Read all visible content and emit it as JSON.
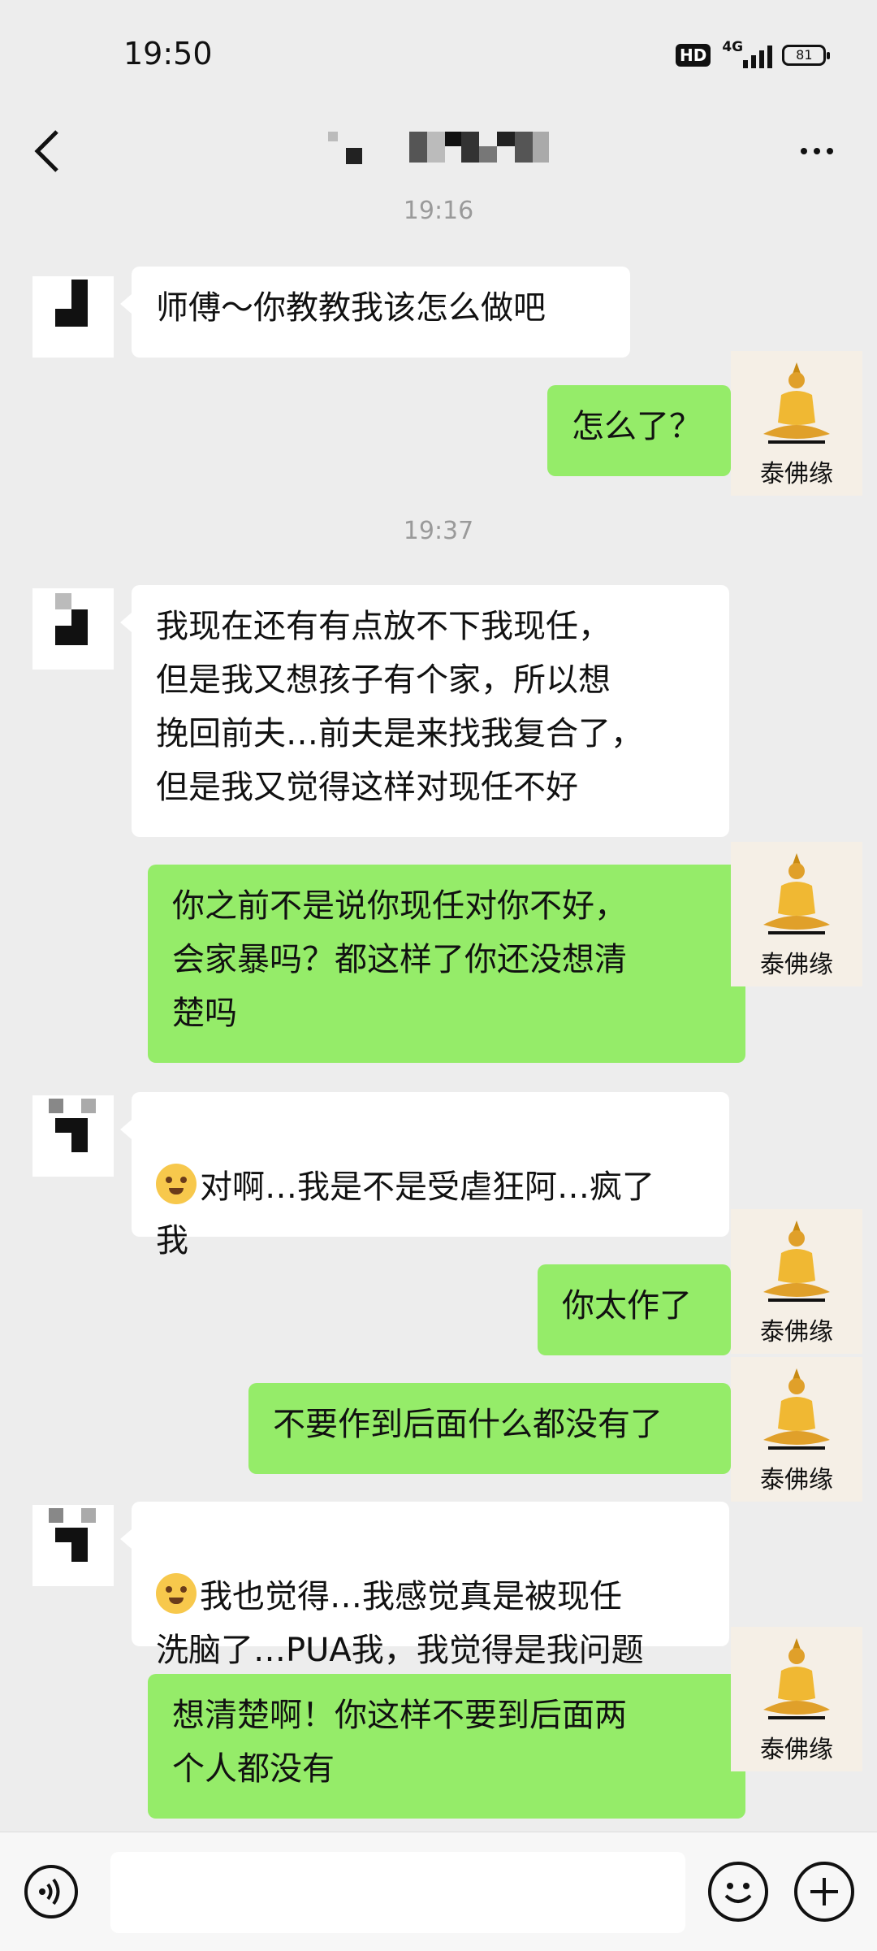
{
  "status_bar": {
    "time": "19:50",
    "hd": "HD",
    "network": "4G",
    "battery": "81"
  },
  "header": {
    "back_icon": "chevron-left-icon",
    "title_censored": true,
    "more_icon": "more-dots-icon"
  },
  "messages": [
    {
      "kind": "timestamp",
      "text": "19:16"
    },
    {
      "kind": "in",
      "text": "师傅～你教教我该怎么做吧"
    },
    {
      "kind": "out",
      "text": "怎么了？"
    },
    {
      "kind": "timestamp",
      "text": "19:37"
    },
    {
      "kind": "in",
      "text": "我现在还有有点放不下我现任，\n但是我又想孩子有个家，所以想\n挽回前夫…前夫是来找我复合了，\n但是我又觉得这样对现任不好"
    },
    {
      "kind": "out",
      "text": "你之前不是说你现任对你不好，\n会家暴吗？都这样了你还没想清\n楚吗"
    },
    {
      "kind": "in",
      "emoji": "crying-emoji",
      "text": "对啊…我是不是受虐狂阿…疯了\n我"
    },
    {
      "kind": "out",
      "text": "你太作了"
    },
    {
      "kind": "out",
      "text": "不要作到后面什么都没有了"
    },
    {
      "kind": "in",
      "emoji": "flushed-emoji",
      "text": "我也觉得…我感觉真是被现任\n洗脑了…PUA我，我觉得是我问题"
    },
    {
      "kind": "out",
      "text": "想清楚啊！你这样不要到后面两\n个人都没有"
    }
  ],
  "self_avatar": {
    "brand": "泰佛缘",
    "icon": "buddha-icon"
  },
  "input_bar": {
    "voice_icon": "voice-icon",
    "emoji_icon": "emoji-icon",
    "plus_icon": "plus-icon"
  },
  "colors": {
    "background": "#ededed",
    "incoming": "#ffffff",
    "outgoing": "#95ec69"
  }
}
